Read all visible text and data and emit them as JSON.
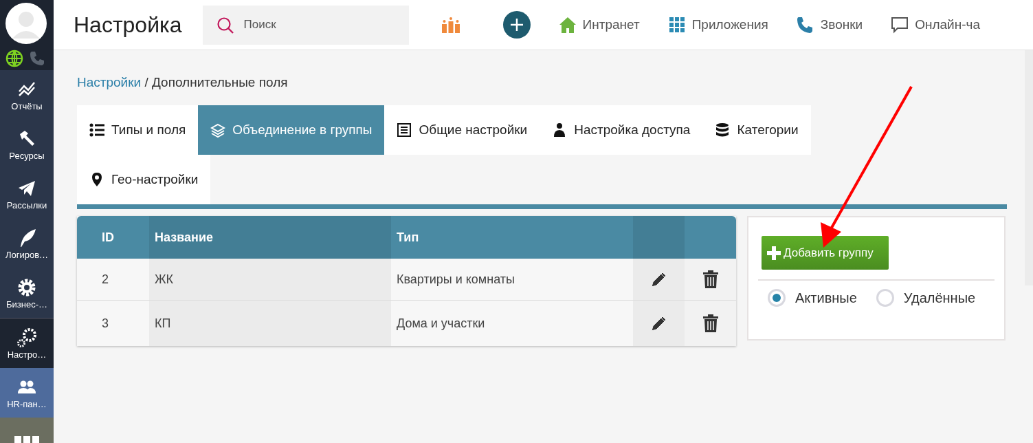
{
  "header": {
    "title": "Настройка",
    "search": {
      "placeholder": "Поиск"
    },
    "links": [
      {
        "kind": "home",
        "label": "Интранет"
      },
      {
        "kind": "grid",
        "label": "Приложения"
      },
      {
        "kind": "phone",
        "label": "Звонки"
      },
      {
        "kind": "chat",
        "label": "Онлайн-ча"
      }
    ]
  },
  "sidebar": {
    "items": [
      {
        "kind": "chart",
        "label": "Отчёты",
        "selected": false,
        "highlighted": false
      },
      {
        "kind": "hammer",
        "label": "Ресурсы",
        "selected": false,
        "highlighted": false
      },
      {
        "kind": "plane",
        "label": "Рассылки",
        "selected": false,
        "highlighted": false
      },
      {
        "kind": "feather",
        "label": "Логиров…",
        "selected": false,
        "highlighted": false
      },
      {
        "kind": "gear",
        "label": "Бизнес-…",
        "selected": false,
        "highlighted": false
      },
      {
        "kind": "gears",
        "label": "Настро…",
        "selected": true,
        "highlighted": false
      },
      {
        "kind": "people",
        "label": "HR-пан…",
        "selected": false,
        "highlighted": true
      }
    ]
  },
  "breadcrumb": {
    "link": "Настройки",
    "current": "/ Дополнительные поля"
  },
  "tabs": [
    {
      "kind": "list",
      "label": "Типы и поля",
      "selected": false
    },
    {
      "kind": "layers",
      "label": "Объединение в группы",
      "selected": true
    },
    {
      "kind": "doc",
      "label": "Общие настройки",
      "selected": false
    },
    {
      "kind": "user",
      "label": "Настройка доступа",
      "selected": false
    },
    {
      "kind": "db",
      "label": "Категории",
      "selected": false
    },
    {
      "kind": "pin",
      "label": "Гео-настройки",
      "selected": false
    }
  ],
  "table": {
    "columns": [
      "ID",
      "Название",
      "Тип"
    ],
    "rows": [
      {
        "cells": [
          "2",
          "ЖК",
          "Квартиры и комнаты"
        ]
      },
      {
        "cells": [
          "3",
          "КП",
          "Дома и участки"
        ]
      }
    ]
  },
  "panel": {
    "add_button": "Добавить группу",
    "filters": [
      {
        "label": "Активные",
        "selected": true
      },
      {
        "label": "Удалённые",
        "selected": false
      }
    ]
  }
}
